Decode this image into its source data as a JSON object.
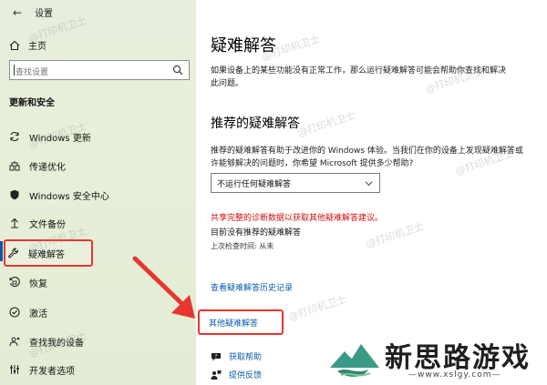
{
  "window": {
    "title": "设置"
  },
  "sidebar": {
    "home_label": "主页",
    "search_placeholder": "查找设置",
    "section_title": "更新和安全",
    "items": [
      {
        "label": "Windows 更新",
        "icon": "sync-icon"
      },
      {
        "label": "传递优化",
        "icon": "delivery-icon"
      },
      {
        "label": "Windows 安全中心",
        "icon": "shield-icon"
      },
      {
        "label": "文件备份",
        "icon": "backup-icon"
      },
      {
        "label": "疑难解答",
        "icon": "wrench-icon"
      },
      {
        "label": "恢复",
        "icon": "recovery-icon"
      },
      {
        "label": "激活",
        "icon": "check-circle-icon"
      },
      {
        "label": "查找我的设备",
        "icon": "person-pin-icon"
      },
      {
        "label": "开发者选项",
        "icon": "developer-icon"
      }
    ]
  },
  "main": {
    "title": "疑难解答",
    "intro": "如果设备上的某些功能没有正常工作，那么运行疑难解答可能会帮助你查找和解决此问题。",
    "recommended_title": "推荐的疑难解答",
    "recommended_desc": "推荐的疑难解答有助于改进你的 Windows 体验。当我们在你的设备上发现疑难解答或许能够解决的问题时，你希望 Microsoft 提供多少帮助?",
    "select_value": "不运行任何疑难解答",
    "diag_link": "共享完整的诊断数据以获取其他疑难解答建议。",
    "no_recommended": "目前没有推荐的疑难解答",
    "last_check": "上次检查时间: 从未",
    "history_link": "查看疑难解答历史记录",
    "other_link": "其他疑难解答",
    "help_link": "获取帮助",
    "feedback_link": "提供反馈"
  },
  "watermark": "@打印机卫士",
  "logo": {
    "name": "新思路游戏",
    "url": "—www.xslgy.com—"
  },
  "colors": {
    "accent": "#0b5cad",
    "highlight_box": "#e8362f",
    "warning_text": "#d10f0f"
  }
}
